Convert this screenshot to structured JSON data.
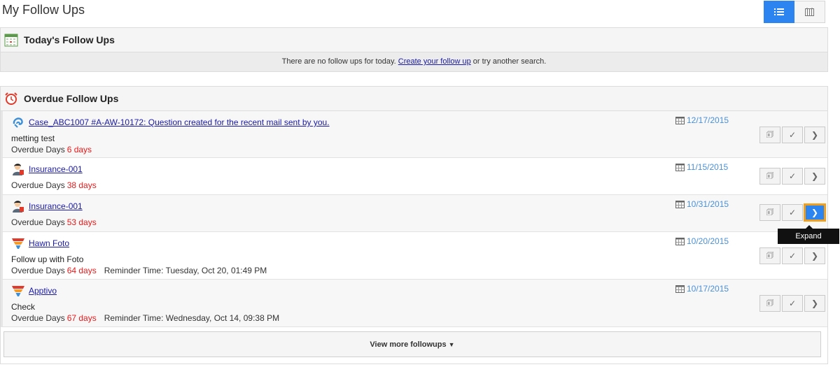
{
  "page": {
    "title": "My Follow Ups",
    "view_list_icon": "list-icon",
    "view_calendar_icon": "calendar-grid-icon"
  },
  "today": {
    "title": "Today's Follow Ups",
    "empty_text_before": "There are no follow ups for today.",
    "create_link": "Create your follow up",
    "empty_text_after": "or try another search."
  },
  "overdue": {
    "title": "Overdue Follow Ups",
    "label_overdue_days": "Overdue Days",
    "label_reminder": "Reminder Time:",
    "items": [
      {
        "icon": "case-icon",
        "title": "Case_ABC1007 #A-AW-10172: Question created for the recent mail sent by you.",
        "note": "metting test",
        "days": "6 days",
        "reminder": "",
        "date": "12/17/2015"
      },
      {
        "icon": "contact-icon",
        "title": "Insurance-001",
        "note": "",
        "days": "38 days",
        "reminder": "",
        "date": "11/15/2015"
      },
      {
        "icon": "contact-icon",
        "title": "Insurance-001",
        "note": "",
        "days": "53 days",
        "reminder": "",
        "date": "10/31/2015"
      },
      {
        "icon": "funnel-icon",
        "title": "Hawn Foto",
        "note": "Follow up with Foto",
        "days": "64 days",
        "reminder": "Tuesday, Oct 20, 01:49 PM",
        "date": "10/20/2015"
      },
      {
        "icon": "funnel-icon",
        "title": "Apptivo",
        "note": "Check",
        "days": "67 days",
        "reminder": "Wednesday, Oct 14, 09:38 PM",
        "date": "10/17/2015"
      }
    ]
  },
  "tooltip": {
    "expand": "Expand"
  },
  "view_more": "View more followups"
}
